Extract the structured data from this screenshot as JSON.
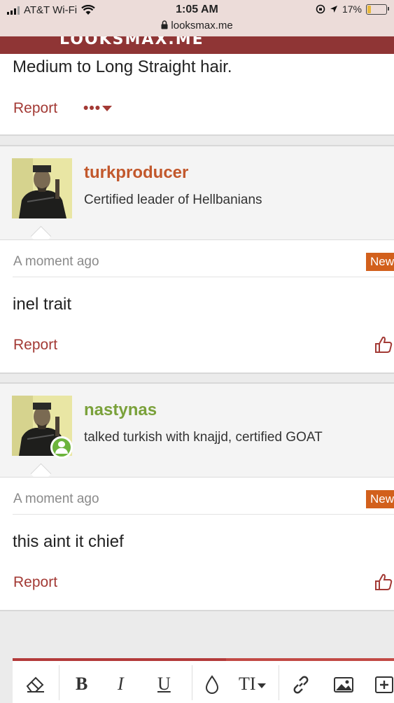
{
  "status_bar": {
    "carrier": "AT&T Wi-Fi",
    "time": "1:05 AM",
    "url": "looksmax.me",
    "battery": "17%"
  },
  "site": {
    "logo": "LOOKSMAX.ME"
  },
  "top_post": {
    "text": "Medium to Long Straight hair.",
    "report_label": "Report",
    "more_label": "•••"
  },
  "posts": [
    {
      "username": "turkproducer",
      "username_color": "#c2582c",
      "user_title": "Certified leader of Hellbanians",
      "time": "A moment ago",
      "badge": "New",
      "message": "inel trait",
      "report_label": "Report",
      "online": false
    },
    {
      "username": "nastynas",
      "username_color": "#7aa13a",
      "user_title": "talked turkish with knajjd, certified GOAT",
      "time": "A moment ago",
      "badge": "New",
      "message": "this aint it chief",
      "report_label": "Report",
      "online": true
    }
  ],
  "editor_toolbar": {
    "bold": "B",
    "italic": "I",
    "underline": "U",
    "text_size": "TI"
  }
}
